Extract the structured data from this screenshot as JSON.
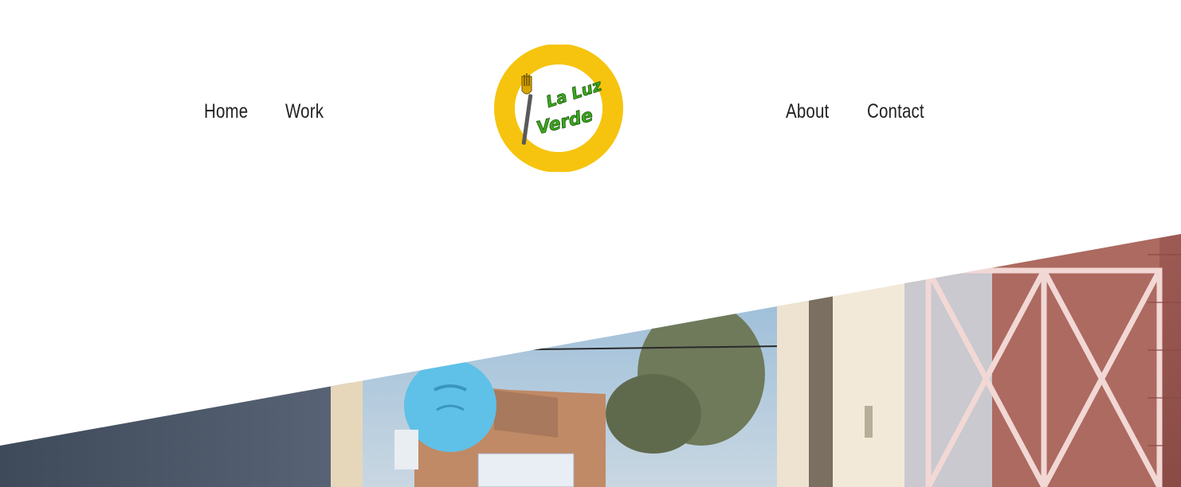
{
  "nav": {
    "left": [
      {
        "label": "Home"
      },
      {
        "label": "Work"
      }
    ],
    "right": [
      {
        "label": "About"
      },
      {
        "label": "Contact"
      }
    ]
  },
  "logo": {
    "text_line1": "La Luz",
    "text_line2": "Verde",
    "ring_color": "#F6C40E",
    "text_color": "#3DA81E",
    "icon": "fork-icon"
  },
  "hero": {
    "image_description": "storefront-photo"
  }
}
